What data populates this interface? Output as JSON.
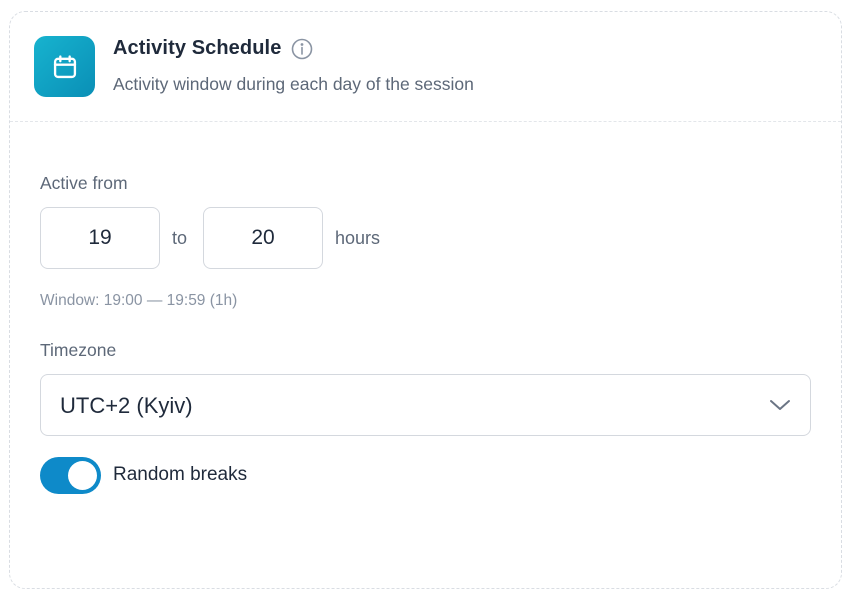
{
  "header": {
    "icon": "calendar-icon",
    "title": "Activity Schedule",
    "info_icon": "info-icon",
    "subtitle": "Activity window during each day of the session"
  },
  "active_hours": {
    "label": "Active from",
    "from_value": "19",
    "to_label": "to",
    "to_value": "20",
    "unit_label": "hours",
    "window_hint": "Window: 19:00 — 19:59 (1h)"
  },
  "timezone": {
    "label": "Timezone",
    "selected": "UTC+2 (Kyiv)",
    "chevron_icon": "chevron-down-icon"
  },
  "random_breaks": {
    "label": "Random breaks",
    "enabled": true
  },
  "colors": {
    "accent": "#0e8ac9",
    "icon_gradient_start": "#17b3cf",
    "icon_gradient_end": "#0a8fb6",
    "text_primary": "#1f2a3b",
    "text_secondary": "#5d6878",
    "text_hint": "#8a94a3"
  }
}
